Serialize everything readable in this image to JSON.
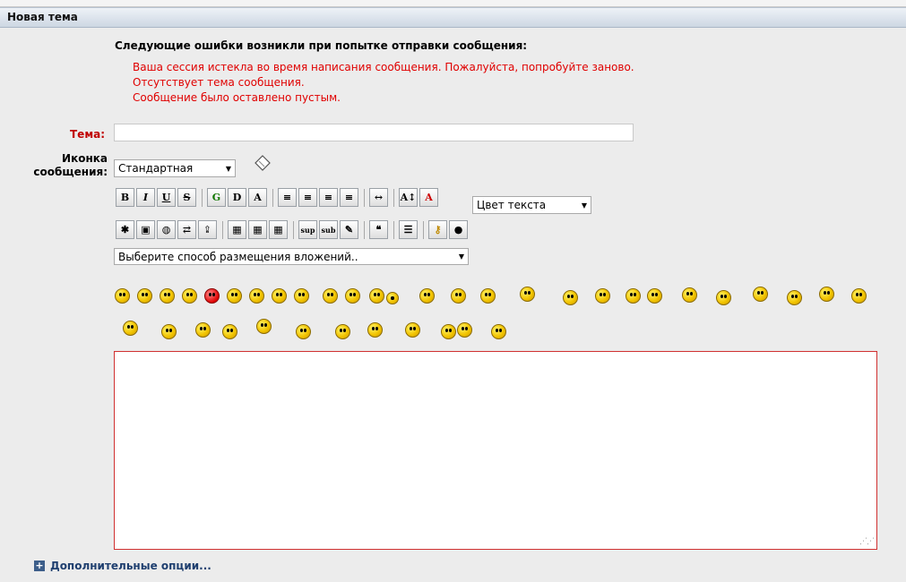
{
  "header": {
    "title": "Новая тема"
  },
  "errors": {
    "title": "Следующие ошибки возникли при попытке отправки сообщения:",
    "items": [
      "Ваша сессия истекла во время написания сообщения. Пожалуйста, попробуйте заново.",
      "Отсутствует тема сообщения.",
      "Сообщение было оставлено пустым."
    ]
  },
  "form": {
    "subject_label": "Тема:",
    "subject_value": "",
    "icon_label_line1": "Иконка",
    "icon_label_line2": "сообщения:",
    "icon_select_value": "Стандартная",
    "text_color_value": "Цвет текста",
    "attach_select_value": "Выберите способ размещения вложений.."
  },
  "toolbar1": [
    "B",
    "I",
    "U",
    "S",
    "G",
    "D",
    "A",
    "left",
    "center-left",
    "center",
    "right",
    "hr",
    "font-size",
    "font-color"
  ],
  "toolbar2": [
    "flash",
    "image",
    "link",
    "swap",
    "export",
    "table1",
    "table2",
    "table3",
    "sup",
    "sub",
    "stamp",
    "quote",
    "list",
    "key",
    "link-out"
  ],
  "toolbar2_labels": {
    "sup": "sup",
    "sub": "sub"
  },
  "colors": {
    "error": "#e00000",
    "subject_label": "#c00000",
    "link": "#1f3f6f",
    "editor_border": "#d03030"
  },
  "smileys_count": 45,
  "more_options": "Дополнительные опции..."
}
